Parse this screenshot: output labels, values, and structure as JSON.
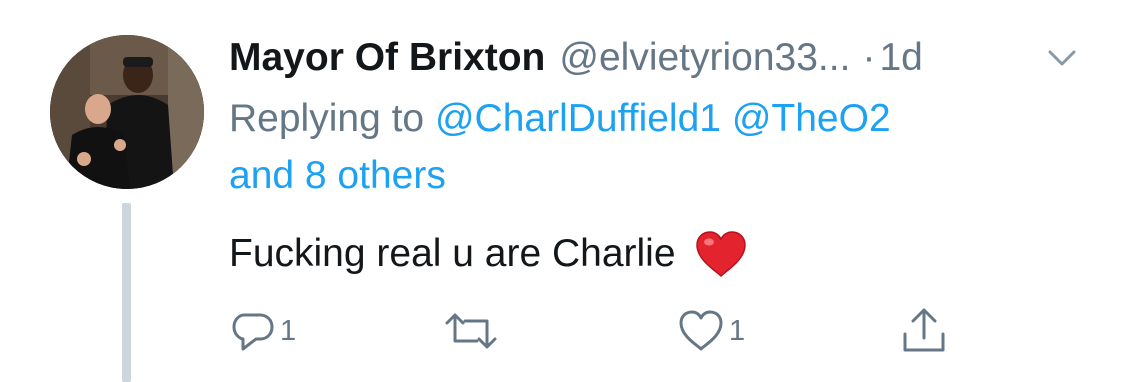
{
  "tweet": {
    "author_name": "Mayor Of Brixton",
    "author_handle": "@elvietyrion33...",
    "separator": "·",
    "timestamp": "1d",
    "replying_prefix": "Replying to",
    "replying_mentions": [
      "@CharlDuffield1",
      "@TheO2"
    ],
    "replying_others": "and 8 others",
    "text": "Fucking real u are Charlie",
    "emoji": "red-heart-emoji"
  },
  "actions": {
    "reply": {
      "icon": "reply-icon",
      "count": "1"
    },
    "retweet": {
      "icon": "retweet-icon",
      "count": ""
    },
    "like": {
      "icon": "heart-icon",
      "count": "1"
    },
    "share": {
      "icon": "share-icon",
      "count": ""
    }
  },
  "colors": {
    "link": "#1da1f2",
    "secondary_text": "#657786",
    "primary_text": "#14171a",
    "thread_line": "#ccd6dd",
    "heart": "#e0245e"
  }
}
